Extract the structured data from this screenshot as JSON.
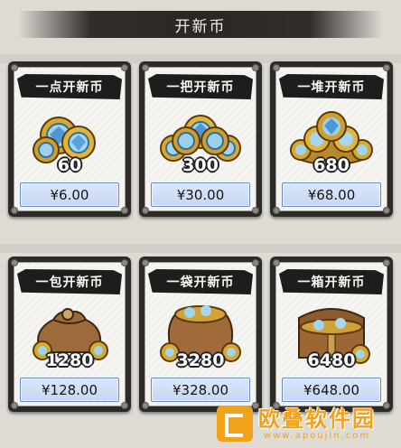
{
  "header": {
    "title": "开新币"
  },
  "packages": [
    {
      "name": "一点开新币",
      "amount": "60",
      "price": "¥6.00",
      "icon": "coin-small-pile"
    },
    {
      "name": "一把开新币",
      "amount": "300",
      "price": "¥30.00",
      "icon": "coin-handful"
    },
    {
      "name": "一堆开新币",
      "amount": "680",
      "price": "¥68.00",
      "icon": "coin-heap"
    },
    {
      "name": "一包开新币",
      "amount": "1280",
      "price": "¥128.00",
      "icon": "coin-pouch"
    },
    {
      "name": "一袋开新币",
      "amount": "3280",
      "price": "¥328.00",
      "icon": "coin-sack"
    },
    {
      "name": "一箱开新币",
      "amount": "6480",
      "price": "¥648.00",
      "icon": "treasure-chest"
    }
  ],
  "watermark": {
    "brand": "欧叠软件园",
    "url": "www.apoujin.com"
  }
}
